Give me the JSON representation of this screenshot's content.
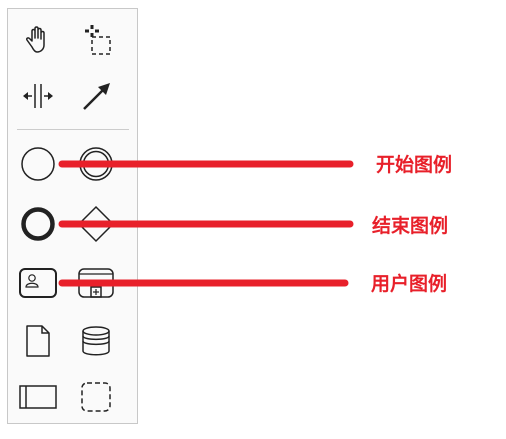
{
  "palette": {
    "tools": [
      {
        "id": "hand-tool"
      },
      {
        "id": "lasso-tool"
      },
      {
        "id": "space-tool"
      },
      {
        "id": "global-connect-tool"
      },
      {
        "id": "start-event"
      },
      {
        "id": "intermediate-event"
      },
      {
        "id": "end-event"
      },
      {
        "id": "gateway"
      },
      {
        "id": "user-task"
      },
      {
        "id": "subprocess"
      },
      {
        "id": "data-object"
      },
      {
        "id": "data-store"
      },
      {
        "id": "pool"
      },
      {
        "id": "group"
      }
    ]
  },
  "annotations": [
    {
      "label": "开始图例"
    },
    {
      "label": "结束图例"
    },
    {
      "label": "用户图例"
    }
  ],
  "colors": {
    "annotation": "#e8202a",
    "icon": "#222222"
  }
}
